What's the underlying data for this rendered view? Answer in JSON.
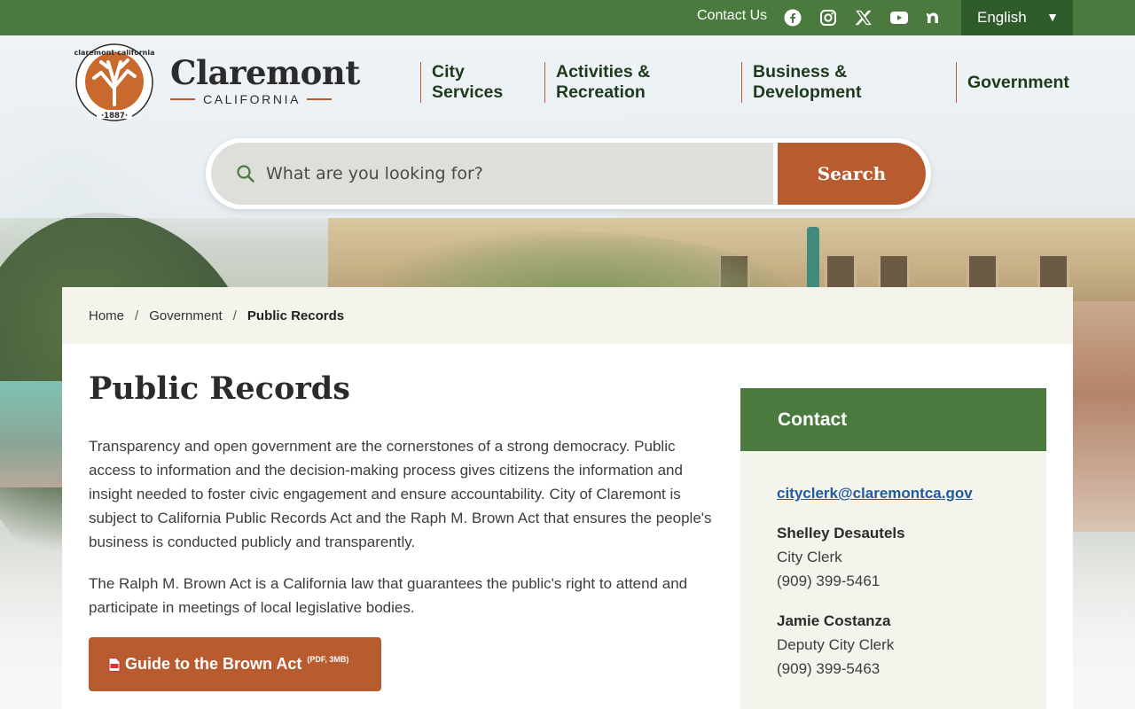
{
  "utility": {
    "contact_label": "Contact Us",
    "social_icons": [
      "facebook-icon",
      "instagram-icon",
      "x-icon",
      "youtube-icon",
      "nextdoor-icon"
    ],
    "language": "English"
  },
  "logo": {
    "name": "Claremont",
    "subtitle": "CALIFORNIA",
    "seal_text": "claremont california",
    "seal_year": "1887"
  },
  "nav": {
    "items": [
      {
        "label": "City Services"
      },
      {
        "label": "Activities & Recreation"
      },
      {
        "label": "Business & Development"
      },
      {
        "label": "Government"
      }
    ]
  },
  "search": {
    "placeholder": "What are you looking for?",
    "button_label": "Search"
  },
  "breadcrumb": {
    "items": [
      "Home",
      "Government"
    ],
    "current": "Public Records",
    "separator": "/"
  },
  "page": {
    "title": "Public Records",
    "paragraphs": [
      "Transparency and open government are the cornerstones of a strong democracy. Public access to information and the decision-making process gives citizens the information and insight needed to foster civic engagement and ensure accountability.  City of Claremont is subject to California Public Records Act and the Raph M. Brown Act that ensures the people's business is conducted publicly and transparently.",
      "The Ralph M. Brown Act is a California law that guarantees the public's right to attend and participate in meetings of local legislative bodies."
    ],
    "guide_button": {
      "label": "Guide to the Brown Act",
      "file_info": "(PDF, 3MB)"
    }
  },
  "contact": {
    "heading": "Contact",
    "email": "cityclerk@claremontca.gov",
    "people": [
      {
        "name": "Shelley Desautels",
        "title": "City Clerk",
        "phone": "(909) 399-5461"
      },
      {
        "name": "Jamie Costanza",
        "title": "Deputy City Clerk",
        "phone": "(909) 399-5463"
      }
    ]
  },
  "colors": {
    "brand_green": "#4b7a3f",
    "dark_green": "#2f5a2a",
    "accent_orange": "#b85c30",
    "link_blue": "#1f5c9e"
  }
}
